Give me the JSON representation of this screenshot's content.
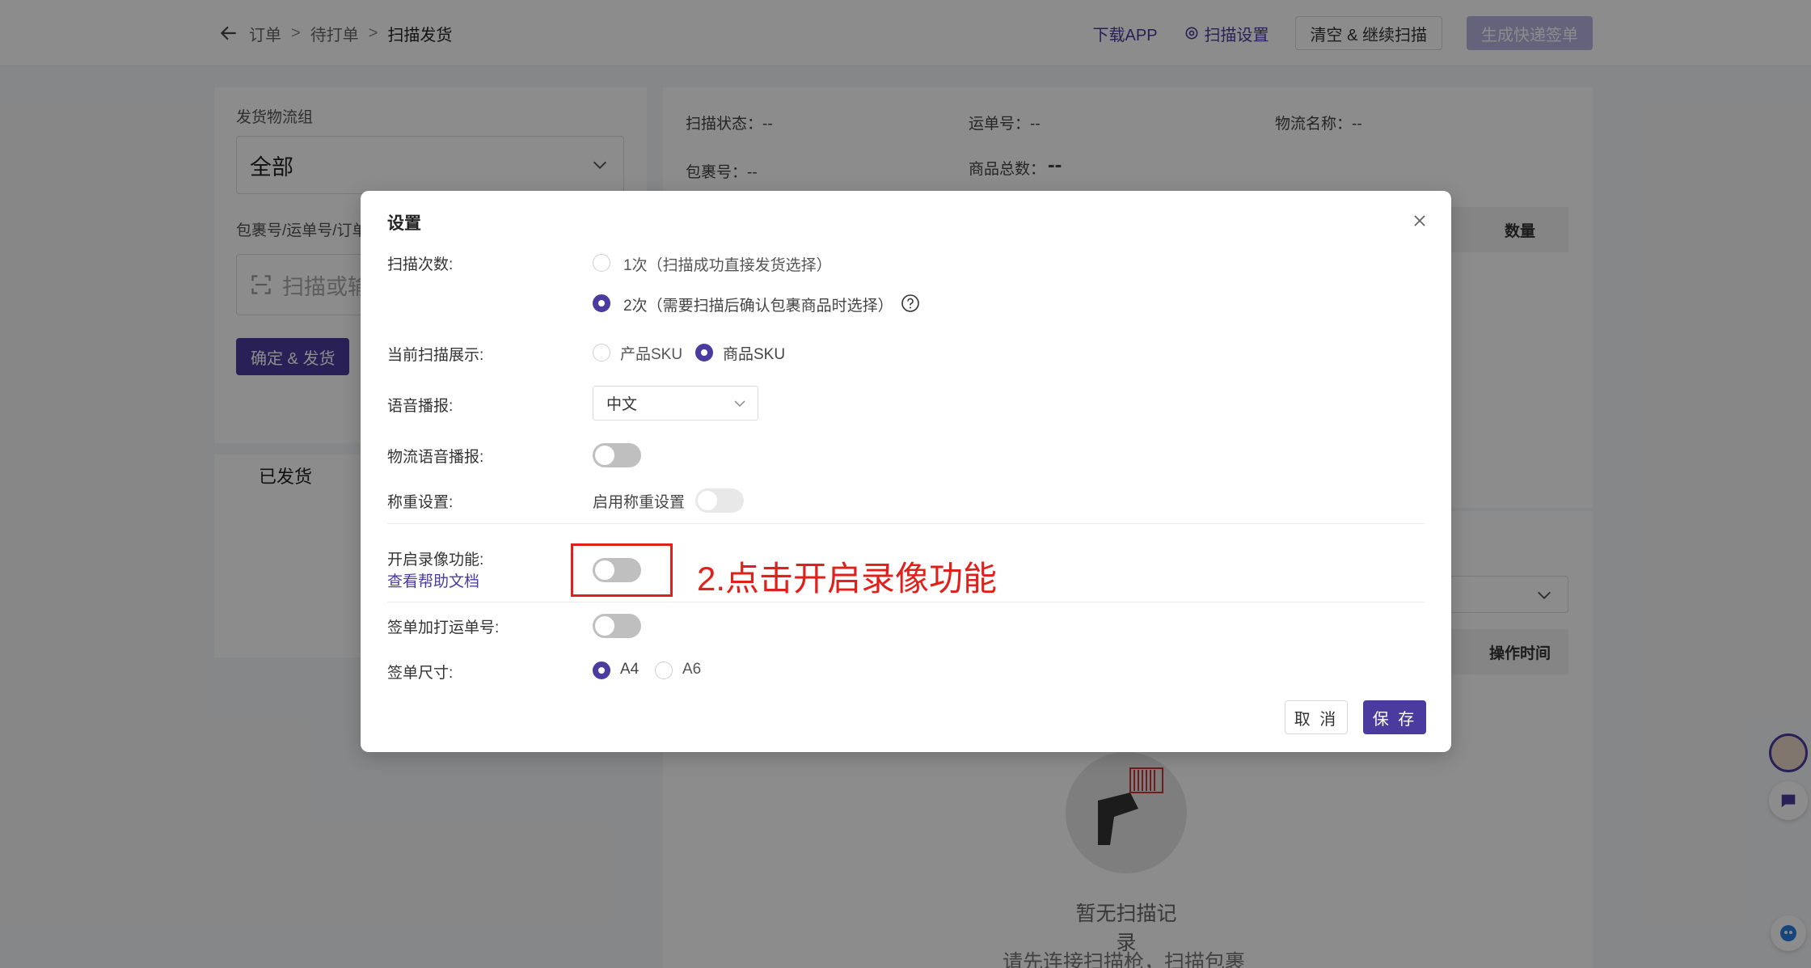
{
  "breadcrumb": {
    "items": [
      "订单",
      "待打单"
    ],
    "current": "扫描发货",
    "separator": ">"
  },
  "topbar": {
    "download_app": "下载APP",
    "scan_settings": "扫描设置",
    "clear_continue": "清空 & 继续扫描",
    "generate_label": "生成快递签单"
  },
  "left": {
    "logistics_group_label": "发货物流组",
    "logistics_group_value": "全部",
    "package_label": "包裹号/运单号/订单",
    "scan_placeholder": "扫描或输",
    "confirm_button": "确定 & 发货",
    "shipped_title": "已发货"
  },
  "right": {
    "scan_status": "扫描状态：--",
    "waybill": "运单号：--",
    "logistics_name": "物流名称：--",
    "package_no": "包裹号：--",
    "goods_total_label": "商品总数：",
    "goods_total_value": "--",
    "col_quantity": "数量",
    "col_op_time": "操作时间",
    "empty_title": "暂无扫描记录",
    "empty_sub": "请先连接扫描枪，扫描包裹"
  },
  "modal": {
    "title": "设置",
    "scan_count_label": "扫描次数:",
    "scan_once": "1次（扫描成功直接发货选择）",
    "scan_twice": "2次（需要扫描后确认包裹商品时选择）",
    "scan_twice_selected": true,
    "display_label": "当前扫描展示:",
    "display_product_sku": "产品SKU",
    "display_goods_sku": "商品SKU",
    "display_selected": "商品SKU",
    "voice_label": "语音播报:",
    "voice_value": "中文",
    "logistics_voice_label": "物流语音播报:",
    "logistics_voice_on": false,
    "weighing_label": "称重设置:",
    "weighing_enable": "启用称重设置",
    "weighing_on": false,
    "recording_label": "开启录像功能:",
    "help_doc": "查看帮助文档",
    "recording_on": false,
    "waybill_print_label": "签单加打运单号:",
    "waybill_print_on": false,
    "label_size_label": "签单尺寸:",
    "size_a4": "A4",
    "size_a6": "A6",
    "size_selected": "A4",
    "cancel": "取 消",
    "save": "保 存"
  },
  "annotation": {
    "text": "2.点击开启录像功能",
    "color": "#e0201a"
  },
  "colors": {
    "primary": "#4c3b9e",
    "primary_disabled": "#b9b2e2"
  }
}
